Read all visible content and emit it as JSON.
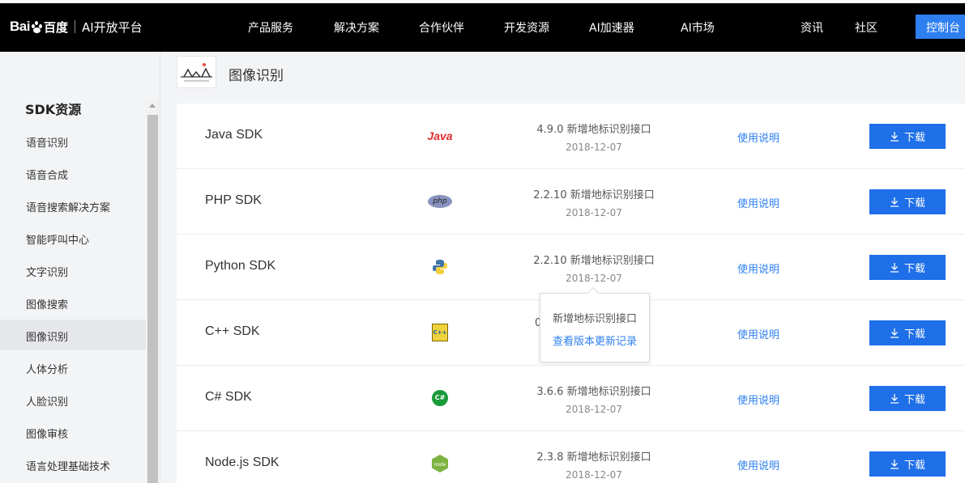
{
  "header": {
    "logo_text": "Bai",
    "logo_du": "百度",
    "platform": "AI开放平台",
    "nav": [
      "产品服务",
      "解决方案",
      "合作伙伴",
      "开发资源",
      "AI加速器",
      "AI市场",
      "资讯",
      "社区"
    ],
    "console": "控制台"
  },
  "sidebar": {
    "title": "SDK资源",
    "items": [
      "语音识别",
      "语音合成",
      "语音搜索解决方案",
      "智能呼叫中心",
      "文字识别",
      "图像搜索",
      "图像识别",
      "人体分析",
      "人脸识别",
      "图像审核",
      "语言处理基础技术"
    ],
    "active": "图像识别"
  },
  "page": {
    "title": "图像识别"
  },
  "sdks": [
    {
      "name": "Java SDK",
      "icon": "java-icon",
      "version": "4.9.0 新增地标识别接口",
      "date": "2018-12-07",
      "usage": "使用说明",
      "download": "下载"
    },
    {
      "name": "PHP SDK",
      "icon": "php-icon",
      "version": "2.2.10 新增地标识别接口",
      "date": "2018-12-07",
      "usage": "使用说明",
      "download": "下载"
    },
    {
      "name": "Python SDK",
      "icon": "python-icon",
      "version": "2.2.10 新增地标识别接口",
      "date": "2018-12-07",
      "usage": "使用说明",
      "download": "下载"
    },
    {
      "name": "C++ SDK",
      "icon": "cpp-icon",
      "version": "0",
      "date": "",
      "usage": "使用说明",
      "download": "下载"
    },
    {
      "name": "C# SDK",
      "icon": "csharp-icon",
      "version": "3.6.6 新增地标识别接口",
      "date": "2018-12-07",
      "usage": "使用说明",
      "download": "下载"
    },
    {
      "name": "Node.js SDK",
      "icon": "nodejs-icon",
      "version": "2.3.8 新增地标识别接口",
      "date": "2018-12-07",
      "usage": "使用说明",
      "download": "下载"
    }
  ],
  "tooltip": {
    "text": "新增地标识别接口",
    "link": "查看版本更新记录"
  },
  "icon_texts": {
    "java": "Java",
    "php": "php",
    "csharp": "C#",
    "cpp": "C++",
    "node": "node"
  },
  "colors": {
    "nav_bg": "#000000",
    "accent": "#1e6fe8",
    "link": "#2e7ff0"
  }
}
